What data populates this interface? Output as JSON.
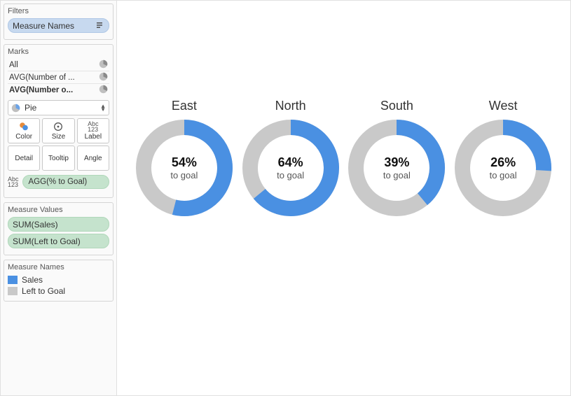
{
  "filters": {
    "title": "Filters",
    "chip": "Measure Names"
  },
  "marks": {
    "title": "Marks",
    "rows": [
      {
        "label": "All",
        "bold": false
      },
      {
        "label": "AVG(Number of ...",
        "bold": false
      },
      {
        "label": "AVG(Number o...",
        "bold": true
      }
    ],
    "type": "Pie",
    "buttons": {
      "color": "Color",
      "size": "Size",
      "label": "Label",
      "detail": "Detail",
      "tooltip": "Tooltip",
      "angle": "Angle"
    },
    "shelf": "AGG(% to Goal)"
  },
  "measure_values": {
    "title": "Measure Values",
    "items": [
      "SUM(Sales)",
      "SUM(Left to Goal)"
    ]
  },
  "legend": {
    "title": "Measure Names",
    "items": [
      {
        "label": "Sales",
        "color": "#4a90e2"
      },
      {
        "label": "Left to Goal",
        "color": "#c9c9c9"
      }
    ]
  },
  "colors": {
    "series": "#4a90e2",
    "remain": "#c9c9c9"
  },
  "to_goal_text": "to goal",
  "chart_data": {
    "type": "pie",
    "title": "",
    "series": [
      {
        "name": "Sales",
        "color": "#4a90e2"
      },
      {
        "name": "Left to Goal",
        "color": "#c9c9c9"
      }
    ],
    "ylim": [
      0,
      100
    ],
    "donuts": [
      {
        "region": "East",
        "pct_to_goal": 54
      },
      {
        "region": "North",
        "pct_to_goal": 64
      },
      {
        "region": "South",
        "pct_to_goal": 39
      },
      {
        "region": "West",
        "pct_to_goal": 26
      }
    ]
  }
}
